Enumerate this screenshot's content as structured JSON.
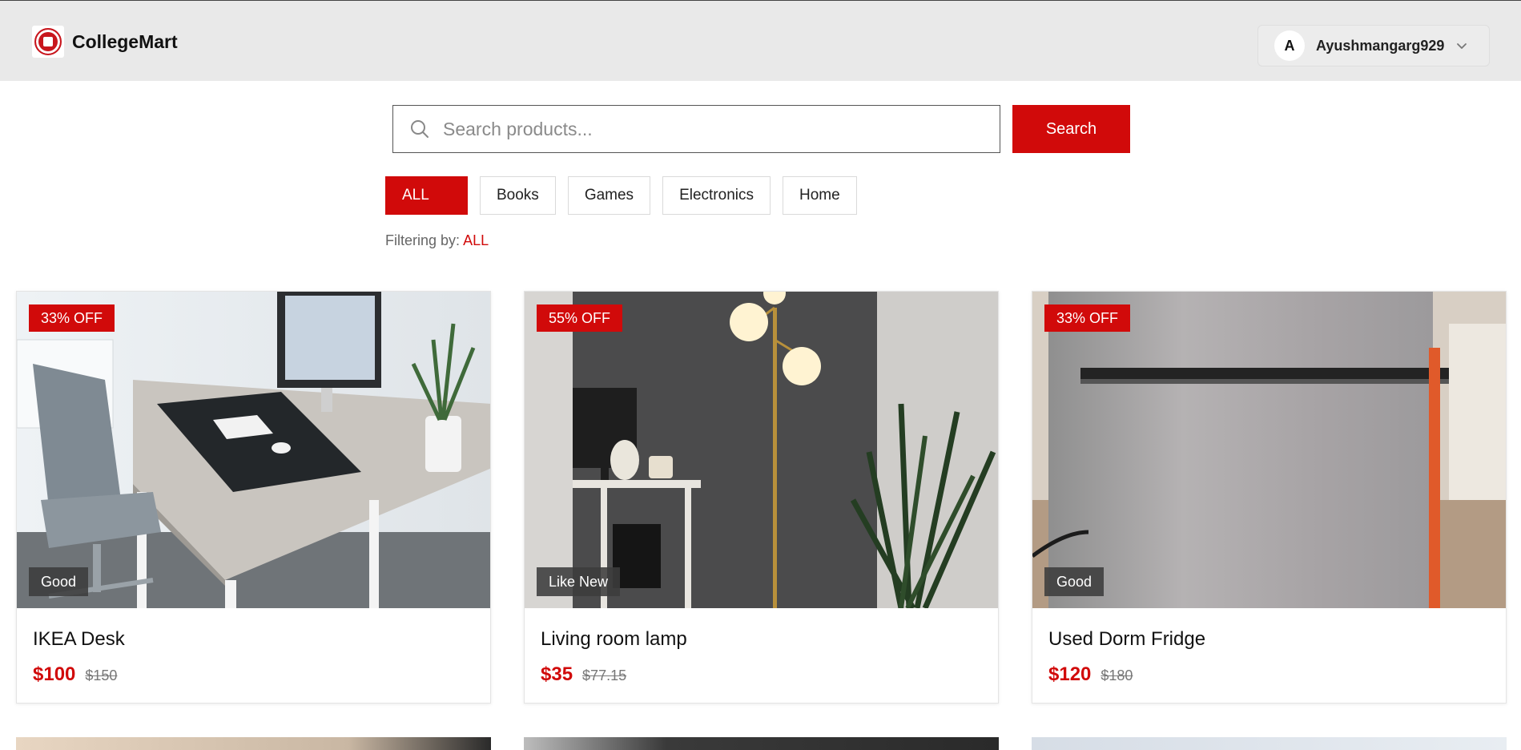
{
  "header": {
    "brand": "CollegeMart",
    "user": {
      "avatar_initial": "A",
      "name": "Ayushmangarg929"
    }
  },
  "search": {
    "placeholder": "Search products...",
    "value": "",
    "button_label": "Search"
  },
  "filters": {
    "categories": [
      "ALL",
      "Books",
      "Games",
      "Electronics",
      "Home"
    ],
    "active": "ALL",
    "status_label": "Filtering by:",
    "status_value": "ALL"
  },
  "products": [
    {
      "title": "IKEA Desk",
      "price": "$100",
      "original_price": "$150",
      "discount": "33% OFF",
      "condition": "Good",
      "image": "desk-photo"
    },
    {
      "title": "Living room lamp",
      "price": "$35",
      "original_price": "$77.15",
      "discount": "55% OFF",
      "condition": "Like New",
      "image": "lamp-photo"
    },
    {
      "title": "Used Dorm Fridge",
      "price": "$120",
      "original_price": "$180",
      "discount": "33% OFF",
      "condition": "Good",
      "image": "fridge-photo"
    }
  ],
  "colors": {
    "accent": "#d10a0a",
    "header_bg": "#e9e9e9"
  }
}
